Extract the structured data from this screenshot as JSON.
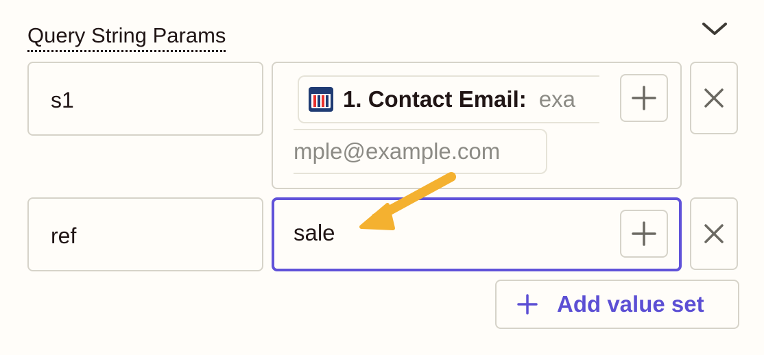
{
  "section": {
    "title": "Query String Params",
    "collapse_icon": "chevron-down-icon"
  },
  "params": [
    {
      "key": "s1",
      "value_pill": {
        "app_icon": "clickfunnels-icon",
        "label": "1. Contact Email:",
        "value_start": "exa",
        "value_end": "mple@example.com"
      },
      "insert_icon": "plus-icon",
      "remove_icon": "close-icon"
    },
    {
      "key": "ref",
      "value": "sale",
      "focused": true,
      "insert_icon": "plus-icon",
      "remove_icon": "close-icon"
    }
  ],
  "add_value_set": {
    "label": "Add value set",
    "icon": "plus-icon"
  },
  "colors": {
    "accent": "#6052d9",
    "accent_text": "#5c4fd4",
    "annotation_arrow": "#f4b130",
    "border": "#d6d3c9",
    "background": "#fffdf9",
    "text": "#201515",
    "muted_text": "#8c8b85"
  }
}
